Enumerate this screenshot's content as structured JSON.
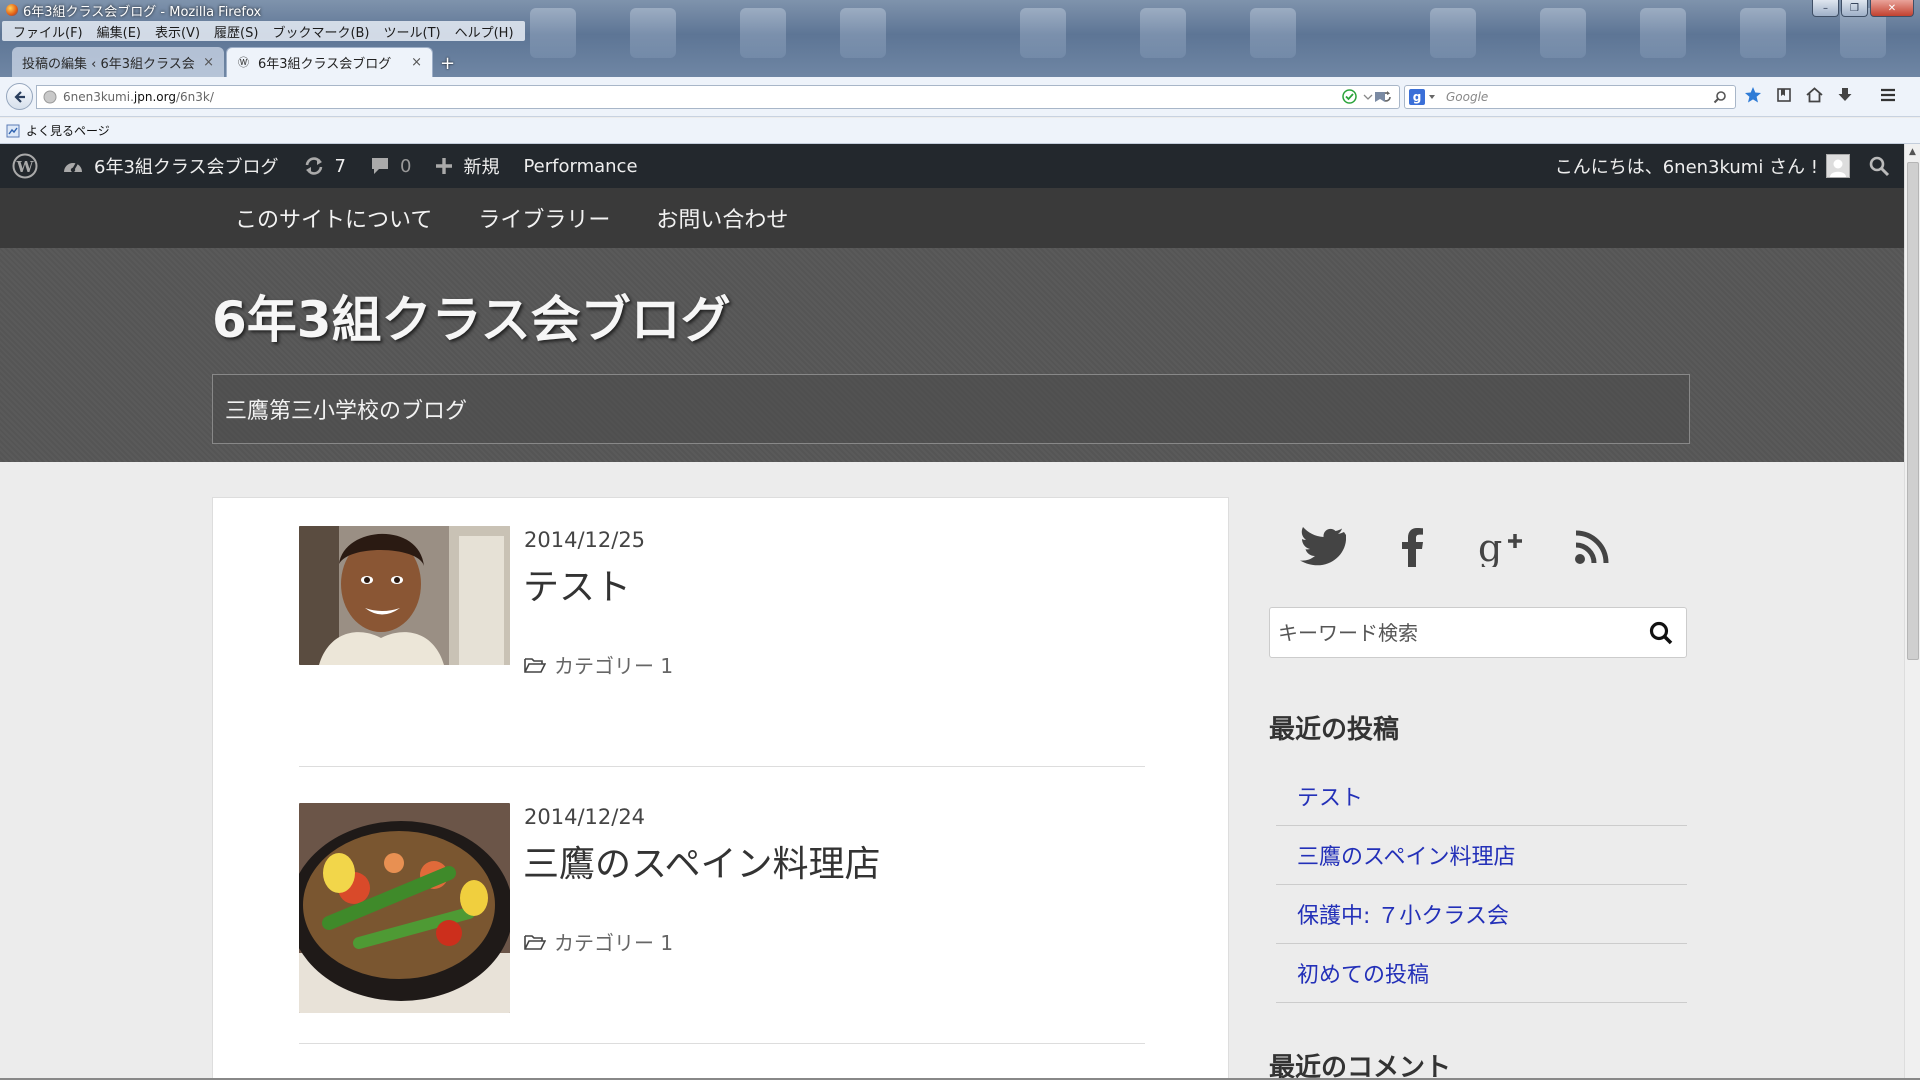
{
  "window": {
    "title": "6年3組クラス会ブログ - Mozilla Firefox",
    "controls": {
      "minimize": "–",
      "maximize": "❐",
      "close": "✕"
    }
  },
  "menubar": [
    "ファイル(F)",
    "編集(E)",
    "表示(V)",
    "履歴(S)",
    "ブックマーク(B)",
    "ツール(T)",
    "ヘルプ(H)"
  ],
  "tabs": [
    {
      "label": "投稿の編集 ‹ 6年3組クラス会…",
      "active": false
    },
    {
      "label": "6年3組クラス会ブログ",
      "active": true
    }
  ],
  "tab_close": "×",
  "new_tab": "+",
  "navbar": {
    "url_prefix": "6nen3kumi.",
    "url_domain": "jpn.org",
    "url_path": "/6n3k/",
    "search_placeholder": "Google",
    "search_engine": "g"
  },
  "bookmarks": {
    "label": "よく見るページ"
  },
  "adminbar": {
    "site_name": "6年3組クラス会ブログ",
    "updates_count": "7",
    "comments_count": "0",
    "new_label": "新規",
    "performance_label": "Performance",
    "greeting": "こんにちは、6nen3kumi さん !"
  },
  "sitenav": [
    "このサイトについて",
    "ライブラリー",
    "お問い合わせ"
  ],
  "header": {
    "site_title": "6年3組クラス会ブログ",
    "description": "三鷹第三小学校のブログ"
  },
  "posts": [
    {
      "date": "2014/12/25",
      "title": "テスト",
      "category": "カテゴリー 1"
    },
    {
      "date": "2014/12/24",
      "title": "三鷹のスペイン料理店",
      "category": "カテゴリー 1"
    }
  ],
  "sidebar": {
    "social": [
      "twitter-icon",
      "facebook-icon",
      "google-plus-icon",
      "rss-icon"
    ],
    "search_placeholder": "キーワード検索",
    "recent_posts_title": "最近の投稿",
    "recent_posts": [
      "テスト",
      "三鷹のスペイン料理店",
      "保護中: ７小クラス会",
      "初めての投稿"
    ],
    "recent_comments_title": "最近のコメント"
  },
  "colors": {
    "admin_bar": "#23282d",
    "site_nav": "#3a3a3a",
    "header": "#575757",
    "link": "#2330b8"
  }
}
